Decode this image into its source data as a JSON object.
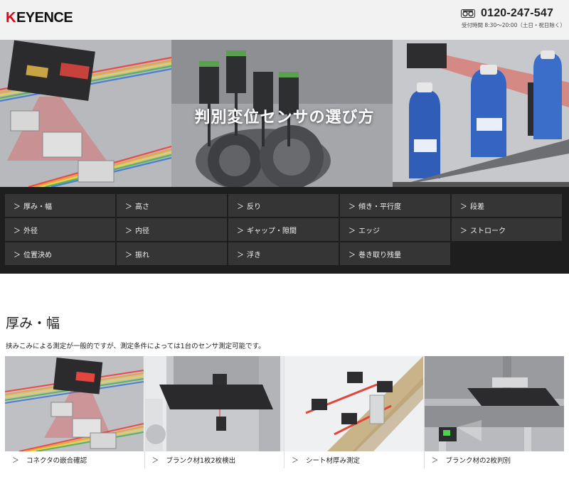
{
  "header": {
    "logo_text": "EYENCE",
    "logo_mark": "K",
    "phone": "0120-247-547",
    "hours": "受付時間 8:30〜20:00（土日・祝日除く）"
  },
  "hero": {
    "title": "判別変位センサの選び方"
  },
  "categories": [
    {
      "label": "厚み・幅"
    },
    {
      "label": "高さ"
    },
    {
      "label": "反り"
    },
    {
      "label": "傾き・平行度"
    },
    {
      "label": "段差"
    },
    {
      "label": "外径"
    },
    {
      "label": "内径"
    },
    {
      "label": "ギャップ・隙間"
    },
    {
      "label": "エッジ"
    },
    {
      "label": "ストローク"
    },
    {
      "label": "位置決め"
    },
    {
      "label": "振れ"
    },
    {
      "label": "浮き"
    },
    {
      "label": "巻き取り残量"
    }
  ],
  "section": {
    "title": "厚み・幅",
    "description": "挟みこみによる測定が一般的ですが、測定条件によっては1台のセンサ測定可能です。"
  },
  "cards": [
    {
      "label": "コネクタの嵌合確認"
    },
    {
      "label": "ブランク材1枚2枚検出"
    },
    {
      "label": "シート材厚み測定"
    },
    {
      "label": "ブランク材の2枚判別"
    }
  ],
  "icons": {
    "chevron": "chevron-right-icon",
    "phone": "freedial-icon"
  },
  "colors": {
    "brand_red": "#e60012",
    "nav_bg": "#1e1e1e",
    "nav_item": "#353535",
    "header_bg": "#f2f2f2"
  }
}
